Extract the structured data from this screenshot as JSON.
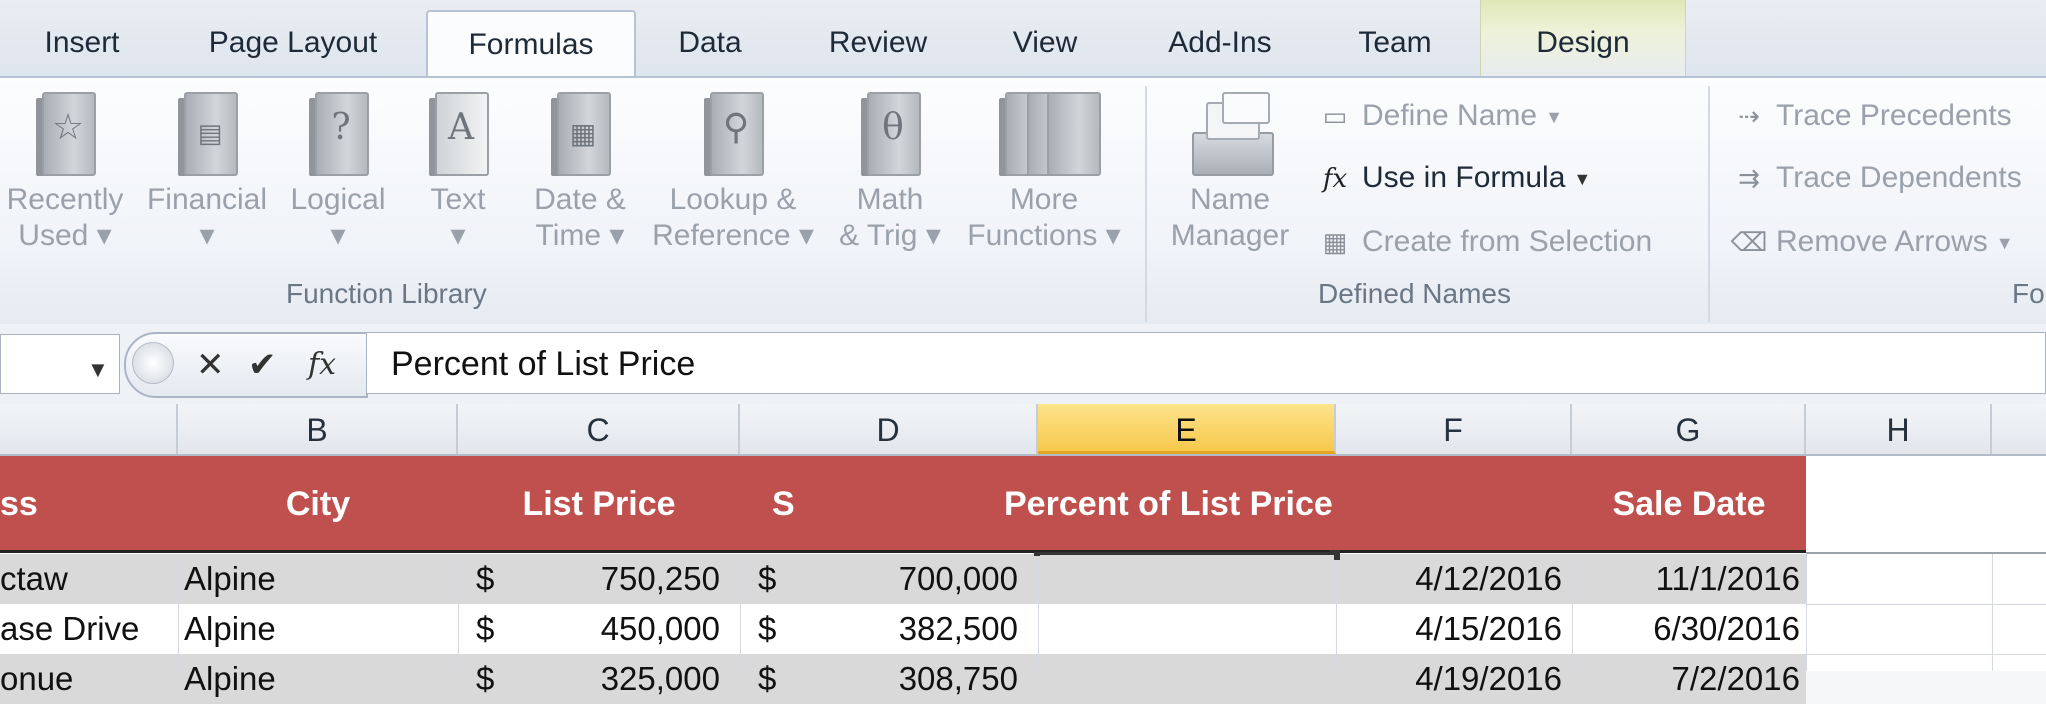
{
  "ribbon_tabs": [
    {
      "label": "Insert"
    },
    {
      "label": "Page Layout"
    },
    {
      "label": "Formulas"
    },
    {
      "label": "Data"
    },
    {
      "label": "Review"
    },
    {
      "label": "View"
    },
    {
      "label": "Add-Ins"
    },
    {
      "label": "Team"
    },
    {
      "label": "Design"
    }
  ],
  "active_tab": "Formulas",
  "function_library": {
    "group_label": "Function Library",
    "buttons": [
      {
        "label": "Recently\nUsed ▾",
        "icon": "star-book-icon"
      },
      {
        "label": "Financial\n▾",
        "icon": "financial-book-icon"
      },
      {
        "label": "Logical\n▾",
        "icon": "logical-book-icon"
      },
      {
        "label": "Text\n▾",
        "icon": "text-book-icon"
      },
      {
        "label": "Date &\nTime ▾",
        "icon": "date-time-book-icon"
      },
      {
        "label": "Lookup &\nReference ▾",
        "icon": "lookup-book-icon"
      },
      {
        "label": "Math\n& Trig ▾",
        "icon": "math-book-icon"
      },
      {
        "label": "More\nFunctions ▾",
        "icon": "more-books-icon"
      }
    ]
  },
  "defined_names": {
    "group_label": "Defined Names",
    "name_manager": "Name\nManager",
    "define_name": "Define Name",
    "use_in_formula": "Use in Formula",
    "create_from_selection": "Create from Selection"
  },
  "formula_auditing": {
    "group_label": "Fo",
    "trace_precedents": "Trace Precedents",
    "trace_dependents": "Trace Dependents",
    "remove_arrows": "Remove Arrows"
  },
  "formula_bar": {
    "cancel": "✕",
    "enter": "✔",
    "fx": "fx",
    "content": "Percent of List Price"
  },
  "columns": [
    "B",
    "C",
    "D",
    "E",
    "F",
    "G",
    "H"
  ],
  "selected_column": "E",
  "table_headers": {
    "address_partial": "ss",
    "city": "City",
    "list_price": "List Price",
    "sale_price_partial": "S",
    "percent": "Percent of List Price",
    "sale_date": "Sale Date"
  },
  "rows": [
    {
      "address": "ctaw",
      "city": "Alpine",
      "lp_cur": "$",
      "lp": "750,250",
      "sp_cur": "$",
      "sp": "700,000",
      "pct": "",
      "listdate": "4/12/2016",
      "saledate": "11/1/2016"
    },
    {
      "address": "ase Drive",
      "city": "Alpine",
      "lp_cur": "$",
      "lp": "450,000",
      "sp_cur": "$",
      "sp": "382,500",
      "pct": "",
      "listdate": "4/15/2016",
      "saledate": "6/30/2016"
    },
    {
      "address": "onue",
      "city": "Alpine",
      "lp_cur": "$",
      "lp": "325,000",
      "sp_cur": "$",
      "sp": "308,750",
      "pct": "",
      "listdate": "4/19/2016",
      "saledate": "7/2/2016"
    }
  ],
  "colors": {
    "header_fill": "#c0504d",
    "band_fill": "#d9d9d9",
    "selected_column": "#f7c84c",
    "design_tab": "#dfe7b8"
  }
}
